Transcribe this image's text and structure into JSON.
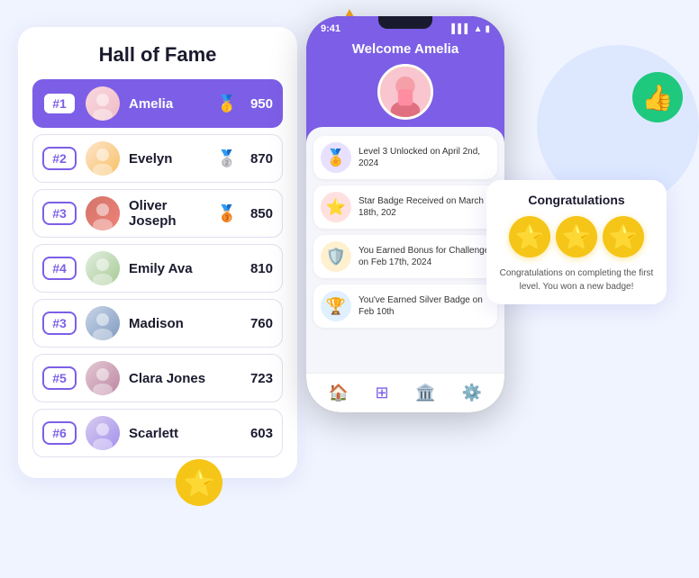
{
  "page": {
    "background_color": "#f0f4ff"
  },
  "decorative": {
    "triangle_color": "#f5a623",
    "circle_green_icon": "👍",
    "circle_star_icon": "⭐"
  },
  "hall_of_fame": {
    "title": "Hall of Fame",
    "rows": [
      {
        "rank": "#1",
        "name": "Amelia",
        "score": "950",
        "medal": "🥇",
        "highlighted": true,
        "avatar_class": "avatar-amelia",
        "avatar_emoji": "👩"
      },
      {
        "rank": "#2",
        "name": "Evelyn",
        "score": "870",
        "medal": "🥈",
        "highlighted": false,
        "avatar_class": "avatar-evelyn",
        "avatar_emoji": "👩"
      },
      {
        "rank": "#3",
        "name": "Oliver Joseph",
        "score": "850",
        "medal": "🥉",
        "highlighted": false,
        "avatar_class": "avatar-oliver",
        "avatar_emoji": "👦"
      },
      {
        "rank": "#4",
        "name": "Emily Ava",
        "score": "810",
        "medal": "",
        "highlighted": false,
        "avatar_class": "avatar-emily",
        "avatar_emoji": "👩"
      },
      {
        "rank": "#3",
        "name": "Madison",
        "score": "760",
        "medal": "",
        "highlighted": false,
        "avatar_class": "avatar-madison",
        "avatar_emoji": "👩"
      },
      {
        "rank": "#5",
        "name": "Clara Jones",
        "score": "723",
        "medal": "",
        "highlighted": false,
        "avatar_class": "avatar-clara",
        "avatar_emoji": "👩"
      },
      {
        "rank": "#6",
        "name": "Scarlett",
        "score": "603",
        "medal": "",
        "highlighted": false,
        "avatar_class": "avatar-scarlett",
        "avatar_emoji": "👩"
      }
    ]
  },
  "phone": {
    "time": "9:41",
    "signal": "▌▌▌",
    "wifi": "▲",
    "battery": "🔋",
    "welcome_text": "Welcome Amelia",
    "user_avatar_emoji": "👩",
    "activities": [
      {
        "icon": "🏅",
        "text": "Level 3 Unlocked\non April 2nd, 2024",
        "icon_bg": "#e8e0ff"
      },
      {
        "icon": "⭐",
        "text": "Star Badge Received\non March 18th, 202",
        "icon_bg": "#ffe0e0"
      },
      {
        "icon": "🛡️",
        "text": "You Earned Bonus\nfor Challenge on\nFeb 17th, 2024",
        "icon_bg": "#fff0d0"
      },
      {
        "icon": "🏆",
        "text": "You've Earned Silver\nBadge on Feb 10th",
        "icon_bg": "#e0f0ff"
      }
    ],
    "nav_items": [
      {
        "icon": "🏠",
        "active": false,
        "name": "home"
      },
      {
        "icon": "⊞",
        "active": true,
        "name": "grid"
      },
      {
        "icon": "🏛️",
        "active": false,
        "name": "leaderboard"
      },
      {
        "icon": "⚙️",
        "active": false,
        "name": "settings"
      }
    ]
  },
  "congrats": {
    "title": "Congratulations",
    "stars_count": 3,
    "star_icon": "⭐",
    "text": "Congratulations on completing the first level. You won a new badge!"
  }
}
